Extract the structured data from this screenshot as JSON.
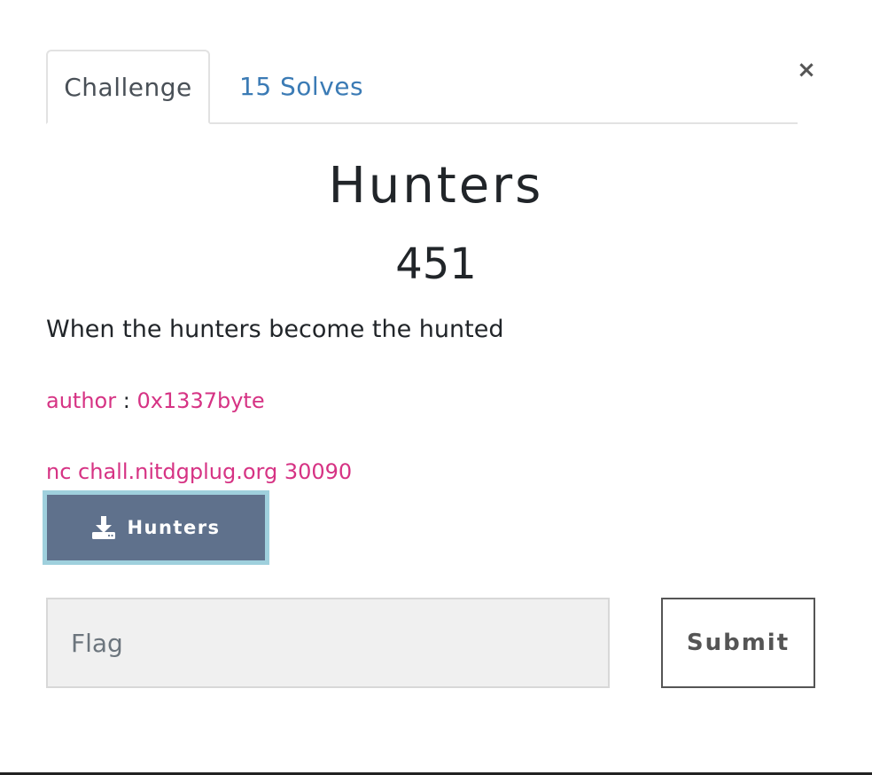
{
  "close_glyph": "×",
  "tabs": [
    {
      "label": "Challenge",
      "active": true
    },
    {
      "label": "15 Solves",
      "active": false
    }
  ],
  "challenge": {
    "name": "Hunters",
    "value": "451",
    "description": "When the hunters become the hunted",
    "author_label": "author",
    "author_separator": " : ",
    "author_name": "0x1337byte",
    "connection": "nc chall.nitdgplug.org 30090"
  },
  "download": {
    "label": "Hunters",
    "icon": "download-icon"
  },
  "flag": {
    "placeholder": "Flag",
    "value": ""
  },
  "submit_label": "Submit",
  "colors": {
    "link_blue": "#3b7bb5",
    "pink": "#d63384",
    "download_bg": "#5f718c",
    "download_border": "#9fd0dd"
  }
}
